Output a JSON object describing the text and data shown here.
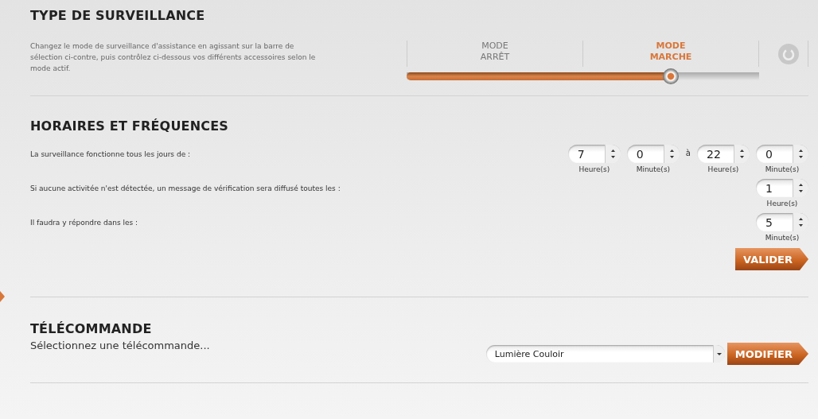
{
  "surveillance": {
    "title": "TYPE DE SURVEILLANCE",
    "description": "Changez le mode de surveillance d'assistance en agissant sur la barre de sélection ci-contre, puis contrôlez ci-dessous vos différents accessoires selon le mode actif.",
    "modes": [
      {
        "label": "MODE ARRÊT",
        "selected": false
      },
      {
        "label": "MODE MARCHE",
        "selected": true
      }
    ],
    "level": 0.75
  },
  "schedule": {
    "title": "HORAIRES ET FRÉQUENCES",
    "rows": [
      {
        "label": "La surveillance fonctionne tous les jours de :",
        "items": [
          {
            "kind": "spinner",
            "value": "7",
            "unit": "Heure(s)"
          },
          {
            "kind": "spinner",
            "value": "0",
            "unit": "Minute(s)"
          },
          {
            "kind": "separator",
            "text": "à"
          },
          {
            "kind": "spinner",
            "value": "22",
            "unit": "Heure(s)"
          },
          {
            "kind": "spinner",
            "value": "0",
            "unit": "Minute(s)"
          }
        ]
      },
      {
        "label": "Si aucune activitée n'est détectée, un message de vérification sera diffusé toutes les :",
        "items": [
          {
            "kind": "spinner",
            "value": "1",
            "unit": "Heure(s)"
          }
        ]
      },
      {
        "label": "Il faudra y répondre dans les :",
        "items": [
          {
            "kind": "spinner",
            "value": "5",
            "unit": "Minute(s)"
          }
        ]
      }
    ],
    "button": "VALIDER"
  },
  "remote": {
    "title": "TÉLÉCOMMANDE",
    "prompt": "Sélectionnez une télécommande...",
    "select": "Lumière Couloir",
    "button": "MODIFIER"
  }
}
